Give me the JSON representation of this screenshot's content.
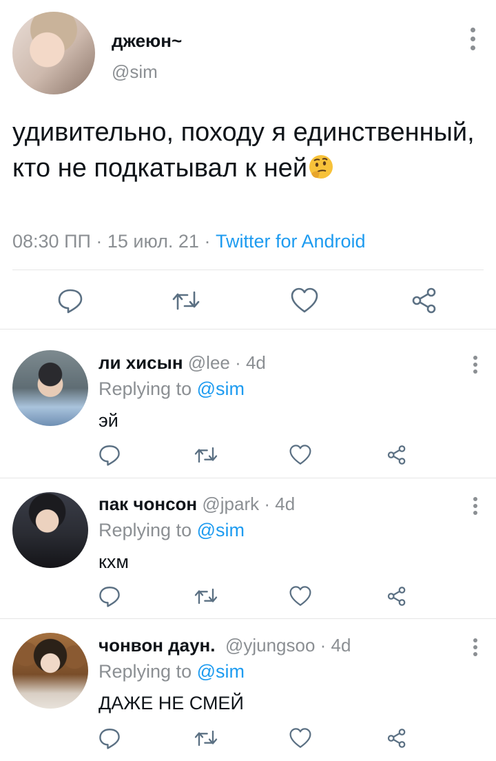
{
  "tweet": {
    "name": "джеюн~",
    "handle": "@sim",
    "text": "удивительно, походу я единственный, кто не подкатывал к ней",
    "emoji": "thinking-face",
    "time": "08:30 ПП · 15 июл. 21 · ",
    "source": "Twitter for Android"
  },
  "replies": [
    {
      "name": "ли хисын",
      "handle": "@lee · 4d",
      "replying_prefix": "Replying to ",
      "replying_to": "@sim",
      "text": "эй"
    },
    {
      "name": "пак чонсон",
      "handle": "@jpark · 4d",
      "replying_prefix": "Replying to ",
      "replying_to": "@sim",
      "text": "кхм"
    },
    {
      "name": "чонвон даун.",
      "handle": "@yjungsoo · 4d",
      "replying_prefix": "Replying to ",
      "replying_to": "@sim",
      "text": "ДАЖЕ НЕ СМЕЙ"
    }
  ],
  "icons": [
    "reply-icon",
    "retweet-icon",
    "like-icon",
    "share-icon",
    "more-options-icon"
  ],
  "colors": {
    "text": "#0f1419",
    "muted": "#8b8f93",
    "link": "#1d9bf0",
    "icon": "#5b7083",
    "divider": "#e6e6e6"
  }
}
